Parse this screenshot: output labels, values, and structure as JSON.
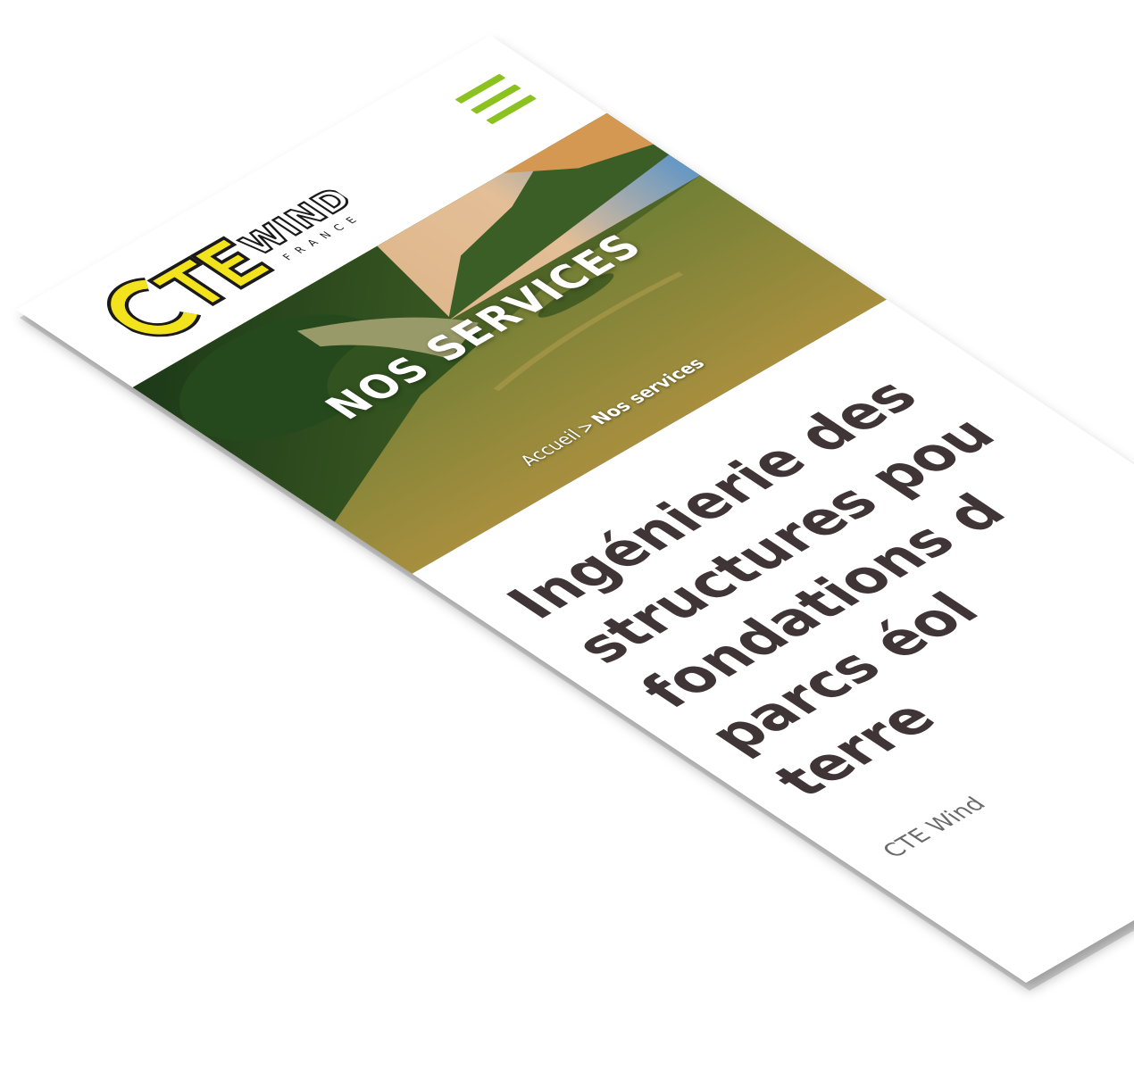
{
  "header": {
    "logo": {
      "primary": "CTE",
      "secondary": "WIND",
      "tagline": "FRANCE"
    },
    "menu_icon": "hamburger-menu-icon"
  },
  "hero": {
    "title": "NOS SERVICES",
    "breadcrumb": {
      "home": "Accueil",
      "separator": ">",
      "current": "Nos services"
    }
  },
  "content": {
    "headline_lines": [
      "Ingénierie des",
      "structures pou",
      "fondations d",
      "parcs éol",
      "terre"
    ],
    "intro_text": "CTE Wind"
  },
  "colors": {
    "accent_green": "#8cc21f",
    "logo_yellow": "#f3e31c",
    "headline_text": "#3f3536"
  }
}
